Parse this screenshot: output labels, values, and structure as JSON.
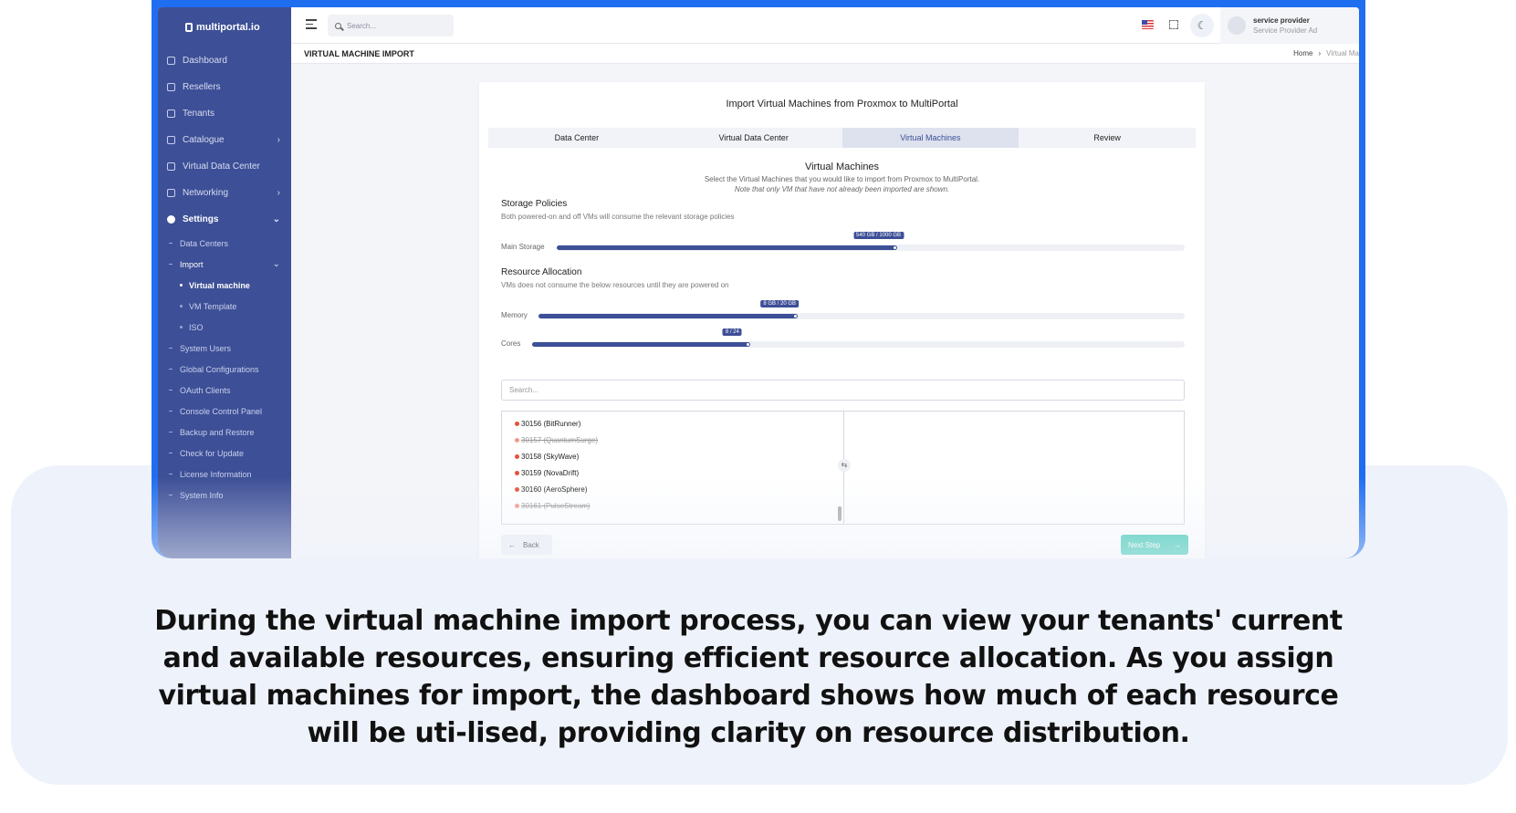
{
  "app": {
    "brand": "multiportal.io"
  },
  "sidebar": {
    "items": [
      {
        "label": "Dashboard",
        "icon": "dashboard-icon"
      },
      {
        "label": "Resellers",
        "icon": "users-icon"
      },
      {
        "label": "Tenants",
        "icon": "users-icon"
      },
      {
        "label": "Catalogue",
        "icon": "tag-icon",
        "arrow": "›"
      },
      {
        "label": "Virtual Data Center",
        "icon": "server-icon"
      },
      {
        "label": "Networking",
        "icon": "network-icon",
        "arrow": "›"
      },
      {
        "label": "Settings",
        "icon": "gear-icon",
        "arrow": "⌄"
      }
    ],
    "settings_sub": [
      "Data Centers",
      "Import",
      "System Users",
      "Global Configurations",
      "OAuth Clients",
      "Console Control Panel",
      "Backup and Restore",
      "Check for Update",
      "License Information",
      "System Info"
    ],
    "import_sub": [
      "Virtual machine",
      "VM Template",
      "ISO"
    ]
  },
  "topbar": {
    "search_placeholder": "Search...",
    "user_name": "service provider",
    "user_role": "Service Provider Ad"
  },
  "page": {
    "title": "VIRTUAL MACHINE IMPORT",
    "breadcrumb": [
      "Home",
      "Virtual Ma"
    ]
  },
  "wizard": {
    "title": "Import Virtual Machines from Proxmox to MultiPortal",
    "steps": [
      "Data Center",
      "Virtual Data Center",
      "Virtual Machines",
      "Review"
    ],
    "active_step": "Virtual Machines",
    "section_title": "Virtual Machines",
    "section_subtitle": "Select the Virtual Machines that you would like to import from Proxmox to MultiPortal.",
    "section_note": "Note that only VM that have not already been imported are shown."
  },
  "storage": {
    "title": "Storage Policies",
    "subtitle": "Both powered-on and off VMs will consume the relevant storage policies",
    "bars": [
      {
        "label": "Main Storage",
        "used": 540,
        "total": 1000,
        "tooltip": "540 GB / 1000 GB"
      }
    ]
  },
  "resources": {
    "title": "Resource Allocation",
    "subtitle": "VMs does not consume the below resources until they are powered on",
    "bars": [
      {
        "label": "Memory",
        "used": 8,
        "total": 20,
        "tooltip": "8 GB / 20 GB"
      },
      {
        "label": "Cores",
        "used": 8,
        "total": 24,
        "tooltip": "8 / 24"
      }
    ]
  },
  "vm_list": {
    "search_placeholder": "Search...",
    "items": [
      {
        "label": "30156 (BitRunner)",
        "imported": false
      },
      {
        "label": "30157 (QuantumSurge)",
        "imported": true
      },
      {
        "label": "30158 (SkyWave)",
        "imported": false
      },
      {
        "label": "30159 (NovaDrift)",
        "imported": false
      },
      {
        "label": "30160 (AeroSphere)",
        "imported": false
      },
      {
        "label": "30161 (PulseStream)",
        "imported": true
      }
    ],
    "swap_icon": "⇆"
  },
  "buttons": {
    "back": "Back",
    "next": "Next Step"
  },
  "caption": "During the virtual machine import process, you can view your tenants' current and available resources, ensuring efficient resource allocation. As you assign virtual machines for import, the dashboard shows how much of each resource will be uti-lised, providing clarity on resource distribution."
}
